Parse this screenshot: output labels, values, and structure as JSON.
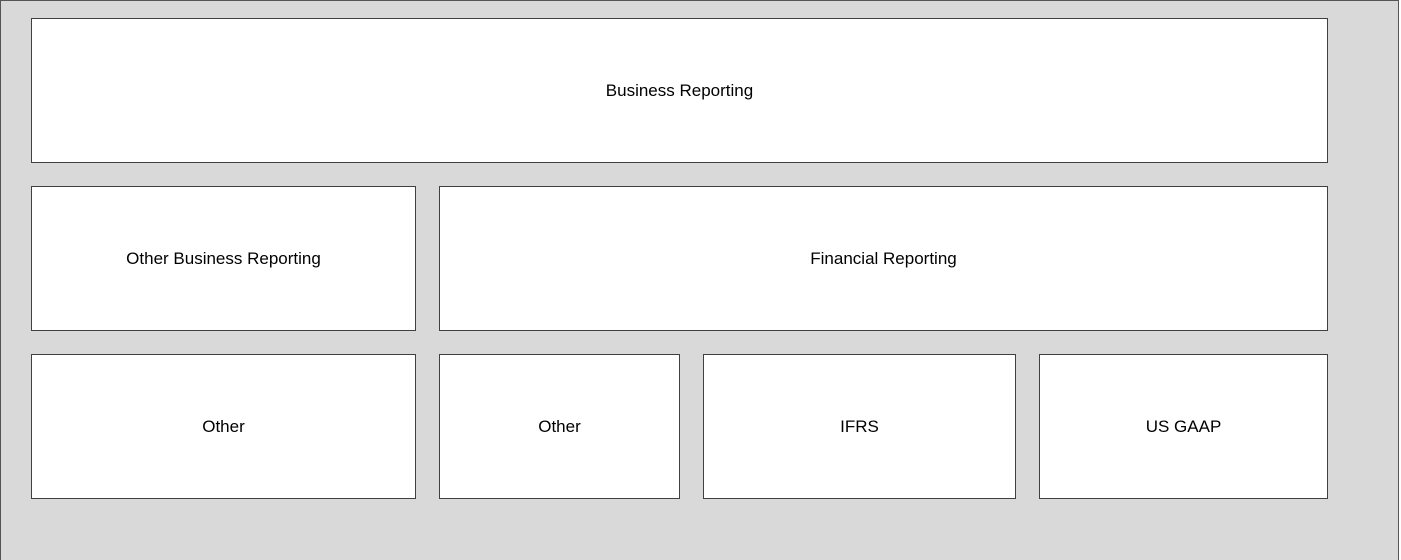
{
  "diagram": {
    "rows": [
      {
        "boxes": [
          {
            "label": "Business Reporting"
          }
        ]
      },
      {
        "boxes": [
          {
            "label": "Other Business Reporting"
          },
          {
            "label": "Financial Reporting"
          }
        ]
      },
      {
        "boxes": [
          {
            "label": "Other"
          },
          {
            "label": "Other"
          },
          {
            "label": "IFRS"
          },
          {
            "label": "US GAAP"
          }
        ]
      }
    ]
  },
  "colors": {
    "background": "#d9d9d9",
    "box_fill": "#ffffff",
    "box_border": "#404040",
    "text": "#000000"
  }
}
